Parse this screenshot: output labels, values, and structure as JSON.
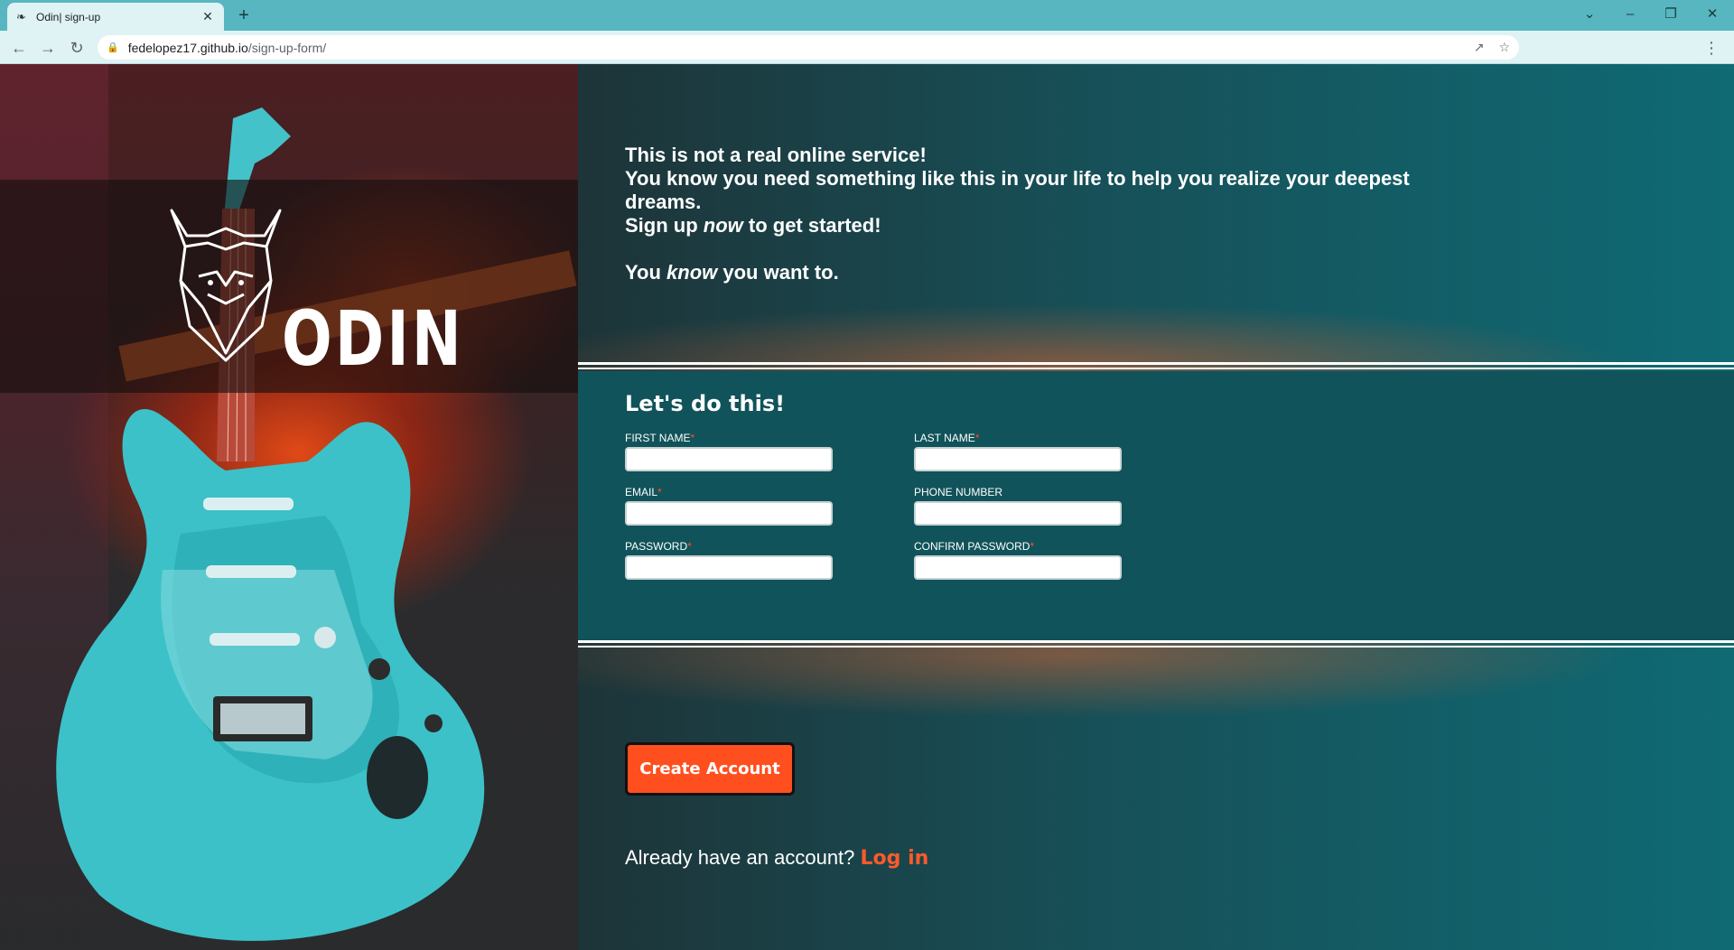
{
  "browser": {
    "tab_title": "Odin| sign-up",
    "tab_favicon": "feather-icon",
    "url_host": "fedelopez17.github.io",
    "url_path": "/sign-up-form/"
  },
  "hero": {
    "logo_word": "ODIN"
  },
  "intro": {
    "line1": "This is not a real online service!",
    "line2": "You know you need something like this in your life to help you realize your deepest dreams.",
    "line3_pre": "Sign up ",
    "line3_em": "now",
    "line3_post": " to get started!",
    "line4_pre": "You ",
    "line4_em": "know",
    "line4_post": " you want to."
  },
  "form": {
    "title": "Let's do this!",
    "fields": {
      "first_name": {
        "label": "FIRST NAME",
        "required": "*",
        "value": ""
      },
      "last_name": {
        "label": "LAST NAME",
        "required": "*",
        "value": ""
      },
      "email": {
        "label": "EMAIL",
        "required": "*",
        "value": ""
      },
      "phone": {
        "label": "PHONE NUMBER",
        "value": ""
      },
      "password": {
        "label": "PASSWORD",
        "required": "*",
        "value": ""
      },
      "confirm_password": {
        "label": "CONFIRM PASSWORD",
        "required": "*",
        "value": ""
      }
    }
  },
  "actions": {
    "create_account": "Create Account",
    "login_prompt": "Already have an account?",
    "login_link": "Log in"
  },
  "colors": {
    "accent": "#ff4f1f",
    "teal": "#11535a",
    "tabbar": "#57b6c0"
  }
}
